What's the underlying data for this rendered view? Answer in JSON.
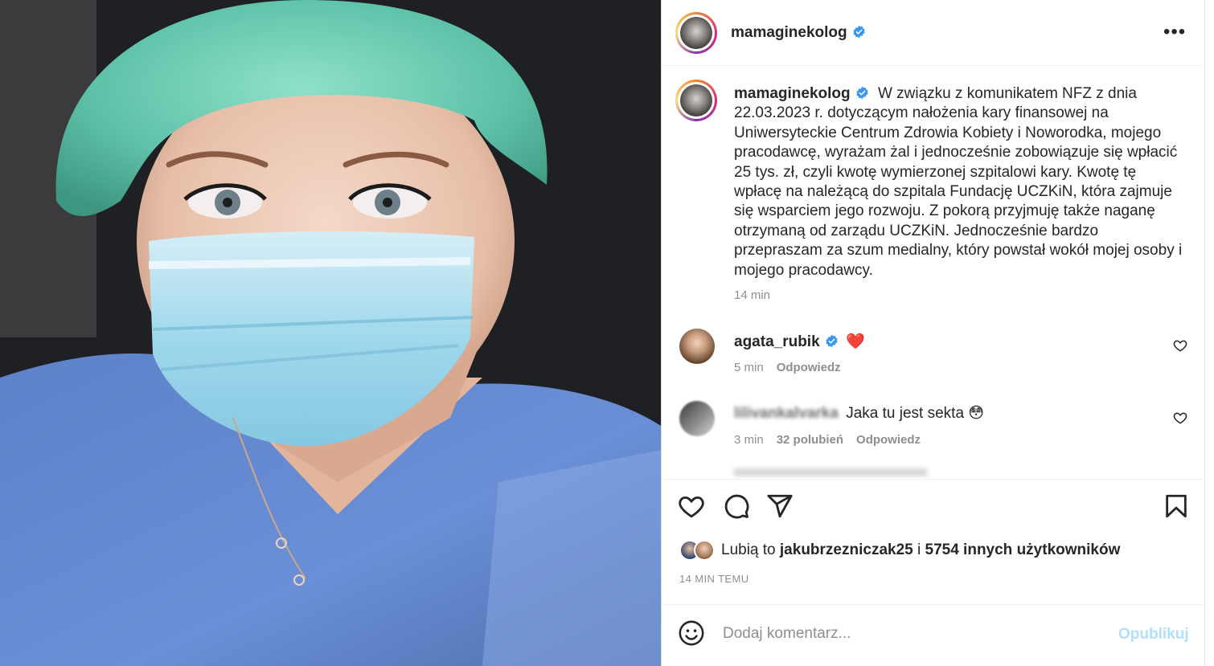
{
  "post": {
    "username": "mamaginekolog",
    "caption_text": "W związku z komunikatem NFZ z dnia 22.03.2023 r. dotyczącym nałożenia kary finansowej na Uniwersyteckie Centrum Zdrowia Kobiety i Noworodka, mojego pracodawcę, wyrażam żal i jednocześnie zobowiązuje się wpłacić 25 tys. zł, czyli kwotę wymierzonej szpitalowi kary. Kwotę tę wpłacę na należącą do szpitala Fundację UCZKiN, która zajmuje się wsparciem jego rozwoju. Z pokorą przyjmuję także naganę otrzymaną od zarządu UCZKiN. Jednocześnie bardzo przepraszam za szum medialny, który powstał wokół mojej osoby i mojego pracodawcy.",
    "caption_time": "14 min"
  },
  "comments": [
    {
      "username": "agata_rubik",
      "text": "❤️",
      "time": "5 min",
      "likes": "",
      "reply_label": "Odpowiedz"
    },
    {
      "username": "lilivankalvarka",
      "text": "Jaka tu jest sekta 😳",
      "time": "3 min",
      "likes": "32 polubień",
      "reply_label": "Odpowiedz"
    }
  ],
  "likes": {
    "prefix": "Lubią to",
    "user": "jakubrzezniczak25",
    "joiner": "i",
    "others": "5754 innych użytkowników"
  },
  "timestamp": "14 MIN TEMU",
  "comment_box": {
    "placeholder": "Dodaj komentarz...",
    "publish_label": "Opublikuj"
  },
  "colors": {
    "verified": "#3897f0",
    "publish_disabled": "#b2dffc",
    "secondary_text": "#8e8e8e"
  },
  "icons": [
    "more-options-icon",
    "verified-badge-icon",
    "heart-icon",
    "comment-icon",
    "share-icon",
    "bookmark-icon",
    "emoji-icon"
  ]
}
